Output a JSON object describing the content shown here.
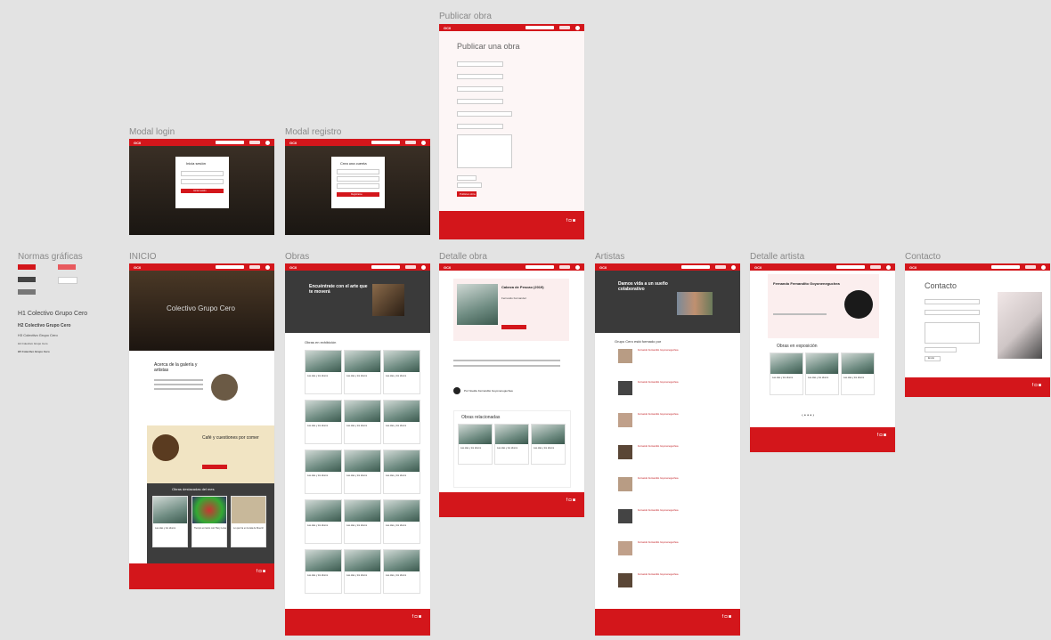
{
  "labels": {
    "publicar": "Publicar obra",
    "modal_login": "Modal login",
    "modal_registro": "Modal registro",
    "normas": "Normas gráficas",
    "inicio": "INICIO",
    "obras": "Obras",
    "detalle_obra": "Detalle obra",
    "artistas": "Artistas",
    "detalle_artista": "Detalle artista",
    "contacto": "Contacto"
  },
  "nav": {
    "logo": "GC0"
  },
  "publicar": {
    "title": "Publicar una obra",
    "submit": "Publicar obra"
  },
  "login": {
    "title": "Inicia sesión",
    "submit": "Iniciar sesión"
  },
  "registro": {
    "title": "Crea una cuenta",
    "submit": "Registrarse"
  },
  "normas": {
    "h1": "H1 Colectivo Grupo Cero",
    "h2": "H2 Colectivo Grupo Cero",
    "h3": "H3 Colectivo Grupo Cero",
    "h4": "H4 Colectivo Grupo Cero",
    "h5": "H5 Colectivo Grupo Cero"
  },
  "inicio": {
    "hero": "Colectivo Grupo Cero",
    "about": "Acerca de la galería y artistas",
    "cafe": "Café y cuestiones por comer",
    "destacadas": "Obras destacadas del mes",
    "card_titles": [
      "Las olas y los siluros",
      "Tiempo en lazos con Hiery Lowe",
      "Lo qué ha en la lata de Muertz"
    ]
  },
  "obras": {
    "hero": "Encuéntrate con el arte que te moverá",
    "section": "Obras en exhibición",
    "card_title": "Las olas y los siluros"
  },
  "detalle": {
    "title": "Cabeza de Pescao (2019)",
    "artist": "Fernando Fernandez",
    "related": "Obras relacionadas",
    "author_line": "Por Noelde Fernandito Goyoneneguchea",
    "card_title": "Las olas y los siluros"
  },
  "artistas": {
    "hero": "Damos vida a un sueño colaborativo",
    "section": "Grupo Cero está formado por",
    "artist_name": "Fernando Fernandito Goyoneneguchea"
  },
  "detalle_artista": {
    "name": "Fernando Fernandito Goyoneneguchea",
    "section": "Obras en exposición",
    "card_title": "Las olas y los siluros"
  },
  "contacto": {
    "title": "Contacto",
    "submit": "Enviar"
  }
}
